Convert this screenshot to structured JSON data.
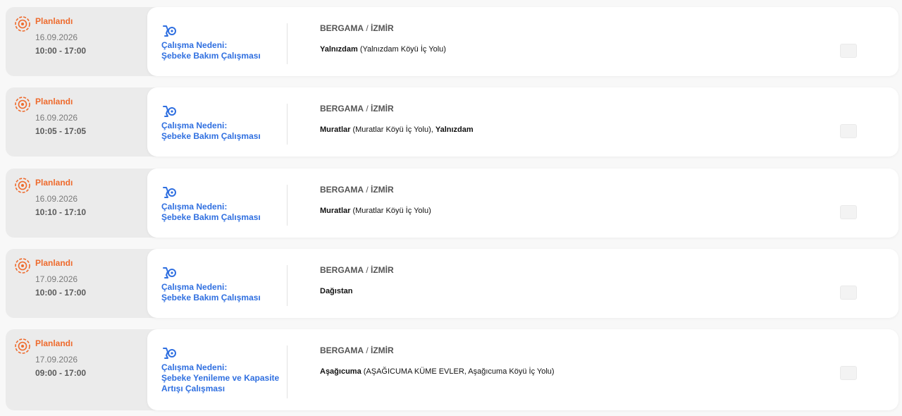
{
  "outages": [
    {
      "status": "Planlandı",
      "date": "16.09.2026",
      "time": "10:00 - 17:00",
      "reason_line1": "Çalışma Nedeni:",
      "reason_line2": "Şebeke Bakım Çalışması",
      "district": "BERGAMA",
      "separator": " / ",
      "city": "İZMİR",
      "areas": [
        {
          "name": "Yalnızdam",
          "detail": " (Yalnızdam Köyü İç Yolu)"
        }
      ]
    },
    {
      "status": "Planlandı",
      "date": "16.09.2026",
      "time": "10:05 - 17:05",
      "reason_line1": "Çalışma Nedeni:",
      "reason_line2": "Şebeke Bakım Çalışması",
      "district": "BERGAMA",
      "separator": " / ",
      "city": "İZMİR",
      "areas": [
        {
          "name": "Muratlar",
          "detail": " (Muratlar Köyü İç Yolu), "
        },
        {
          "name": "Yalnızdam",
          "detail": ""
        }
      ]
    },
    {
      "status": "Planlandı",
      "date": "16.09.2026",
      "time": "10:10 - 17:10",
      "reason_line1": "Çalışma Nedeni:",
      "reason_line2": "Şebeke Bakım Çalışması",
      "district": "BERGAMA",
      "separator": " / ",
      "city": "İZMİR",
      "areas": [
        {
          "name": "Muratlar",
          "detail": " (Muratlar Köyü İç Yolu)"
        }
      ]
    },
    {
      "status": "Planlandı",
      "date": "17.09.2026",
      "time": "10:00 - 17:00",
      "reason_line1": "Çalışma Nedeni:",
      "reason_line2": "Şebeke Bakım Çalışması",
      "district": "BERGAMA",
      "separator": " / ",
      "city": "İZMİR",
      "areas": [
        {
          "name": "Dağıstan",
          "detail": ""
        }
      ]
    },
    {
      "status": "Planlandı",
      "date": "17.09.2026",
      "time": "09:00 - 17:00",
      "reason_line1": "Çalışma Nedeni:",
      "reason_line2": "Şebeke Yenileme ve Kapasite Artışı Çalışması",
      "district": "BERGAMA",
      "separator": " / ",
      "city": "İZMİR",
      "areas": [
        {
          "name": "Aşağıcuma",
          "detail": " (AŞAĞICUMA KÜME EVLER, Aşağıcuma Köyü İç Yolu)"
        }
      ]
    }
  ],
  "icons": {
    "status": "planned-gear-icon",
    "reason": "maintenance-tools-icon",
    "expand": "expand-icon"
  },
  "colors": {
    "status": "#ee6a2c",
    "reason": "#2f6fe0",
    "side_bg": "#ebebeb",
    "card_bg": "#ffffff"
  }
}
